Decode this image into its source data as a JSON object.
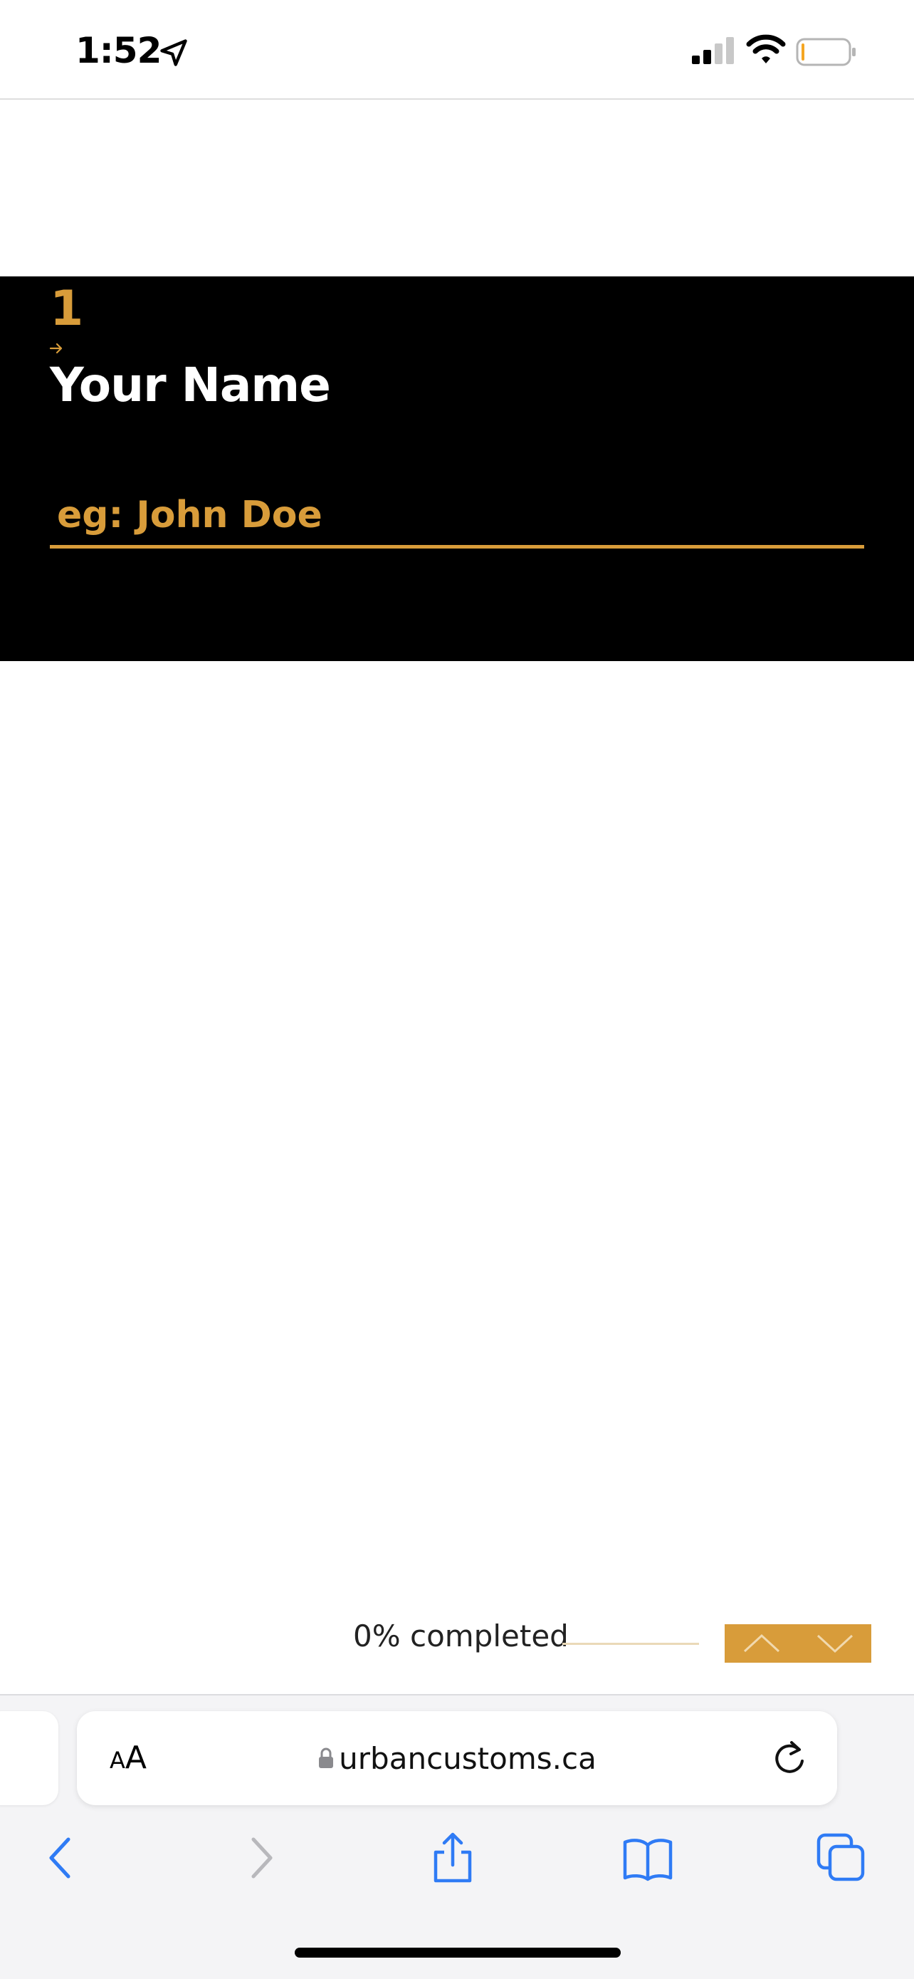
{
  "status_bar": {
    "time": "1:52",
    "icons": [
      "location-arrow-icon",
      "cellular-signal-icon",
      "wifi-icon",
      "battery-icon"
    ]
  },
  "question": {
    "number": "1",
    "arrow_icon": "right-arrow-icon",
    "title": "Your Name",
    "input_placeholder": "eg: John Doe",
    "input_value": ""
  },
  "progress": {
    "label": "0% completed",
    "percent": 0,
    "prev_icon": "chevron-up-icon",
    "next_icon": "chevron-down-icon"
  },
  "browser": {
    "text_size_label": "AA",
    "url": "urbancustoms.ca",
    "toolbar_icons": [
      "back-icon",
      "forward-icon",
      "share-icon",
      "bookmarks-icon",
      "tabs-icon"
    ]
  },
  "colors": {
    "accent": "#d89c3a",
    "panel_background": "#000000",
    "title_text": "#ffffff",
    "ios_blue": "#2f7bf5"
  }
}
